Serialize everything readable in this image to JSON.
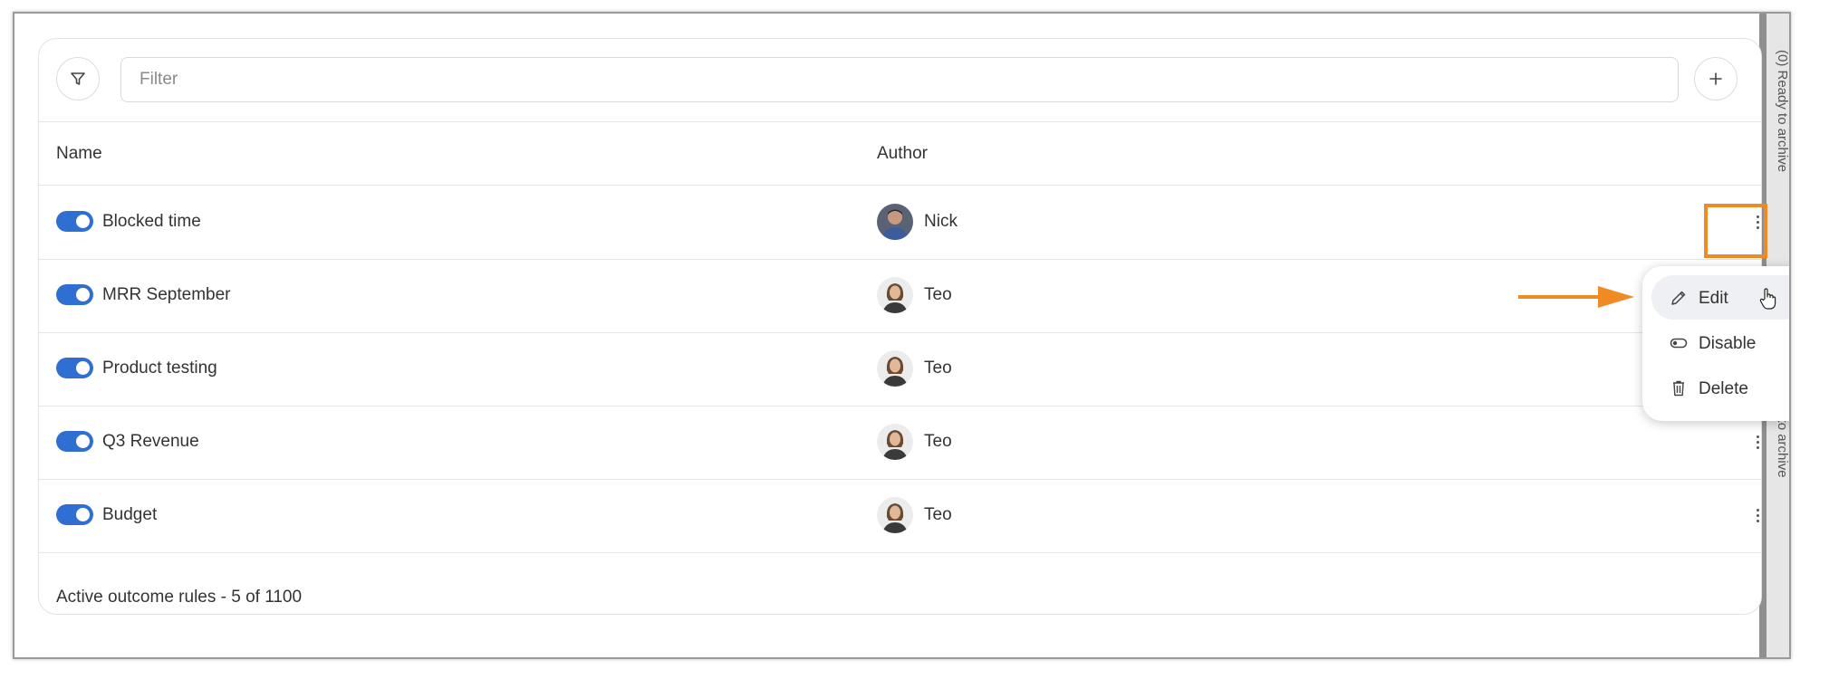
{
  "side_panel": {
    "texts": [
      "(0) Ready to archive",
      "Ready to archive"
    ]
  },
  "toolbar": {
    "filter_placeholder": "Filter",
    "filter_icon": "funnel-icon",
    "add_icon": "plus-icon"
  },
  "table": {
    "columns": [
      "Name",
      "Author"
    ],
    "rows": [
      {
        "name": "Blocked time",
        "author": "Nick",
        "enabled": true
      },
      {
        "name": "MRR September",
        "author": "Teo",
        "enabled": true
      },
      {
        "name": "Product testing",
        "author": "Teo",
        "enabled": true
      },
      {
        "name": "Q3 Revenue",
        "author": "Teo",
        "enabled": true
      },
      {
        "name": "Budget",
        "author": "Teo",
        "enabled": true
      }
    ]
  },
  "footer": {
    "text": "Active outcome rules - 5 of 1100"
  },
  "context_menu": {
    "items": [
      {
        "label": "Edit",
        "icon": "pencil-icon"
      },
      {
        "label": "Disable",
        "icon": "toggle-off-icon"
      },
      {
        "label": "Delete",
        "icon": "trash-icon"
      }
    ]
  },
  "colors": {
    "accent": "#2f6fd1",
    "highlight": "#f08a24"
  }
}
